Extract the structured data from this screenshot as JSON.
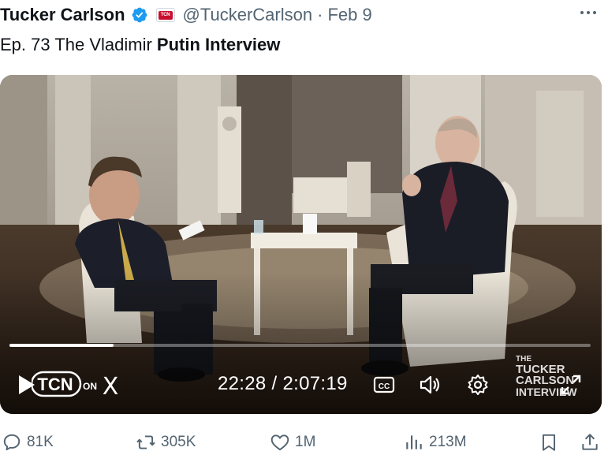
{
  "author": {
    "name": "Tucker Carlson",
    "verified_icon": "verified-badge-icon",
    "affiliate_badge": "TCN",
    "handle": "@TuckerCarlson",
    "separator": "·",
    "date": "Feb 9"
  },
  "tweet": {
    "text_prefix": "Ep. 73  The Vladimir ",
    "text_bold": "Putin Interview"
  },
  "video": {
    "progress_fraction": 0.179,
    "time": "22:28 / 2:07:19",
    "logo_text": "TCN",
    "logo_suffix": "ON",
    "logo_x": "X",
    "watermark": [
      "THE",
      "TUCKER",
      "CARLSON",
      "INTERVIEW"
    ],
    "controls": [
      "play-icon",
      "captions-icon",
      "volume-icon",
      "settings-icon",
      "fullscreen-icon"
    ]
  },
  "actions": {
    "replies": "81K",
    "reposts": "305K",
    "likes": "1M",
    "views": "213M"
  },
  "colors": {
    "text": "#0f1419",
    "secondary": "#536471",
    "verified": "#1d9bf0"
  }
}
